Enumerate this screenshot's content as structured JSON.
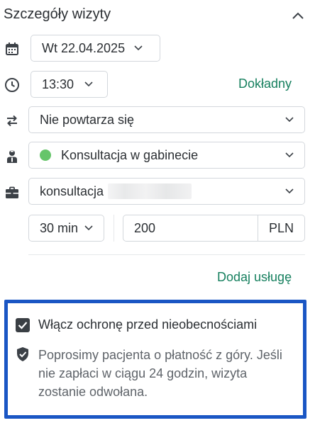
{
  "header": {
    "title": "Szczegóły wizyty"
  },
  "date": {
    "value": "Wt 22.04.2025"
  },
  "time": {
    "value": "13:30",
    "exact_link": "Dokładny"
  },
  "repeat": {
    "value": "Nie powtarza się"
  },
  "location": {
    "value": "Konsultacja w gabinecie",
    "status_color": "#66c56a"
  },
  "service": {
    "value": "konsultacja"
  },
  "duration": {
    "value": "30 min"
  },
  "price": {
    "value": "200",
    "currency": "PLN"
  },
  "add_service": {
    "label": "Dodaj usługę"
  },
  "protection": {
    "checked": true,
    "label": "Włącz ochronę przed nieobecnościami",
    "description": "Poprosimy pacjenta o płatność z góry. Jeśli nie zapłaci w ciągu 24 godzin, wizyta zostanie odwołana."
  },
  "colors": {
    "accent": "#17805f",
    "highlight_border": "#1a56c4",
    "border": "#d3d7dc"
  }
}
